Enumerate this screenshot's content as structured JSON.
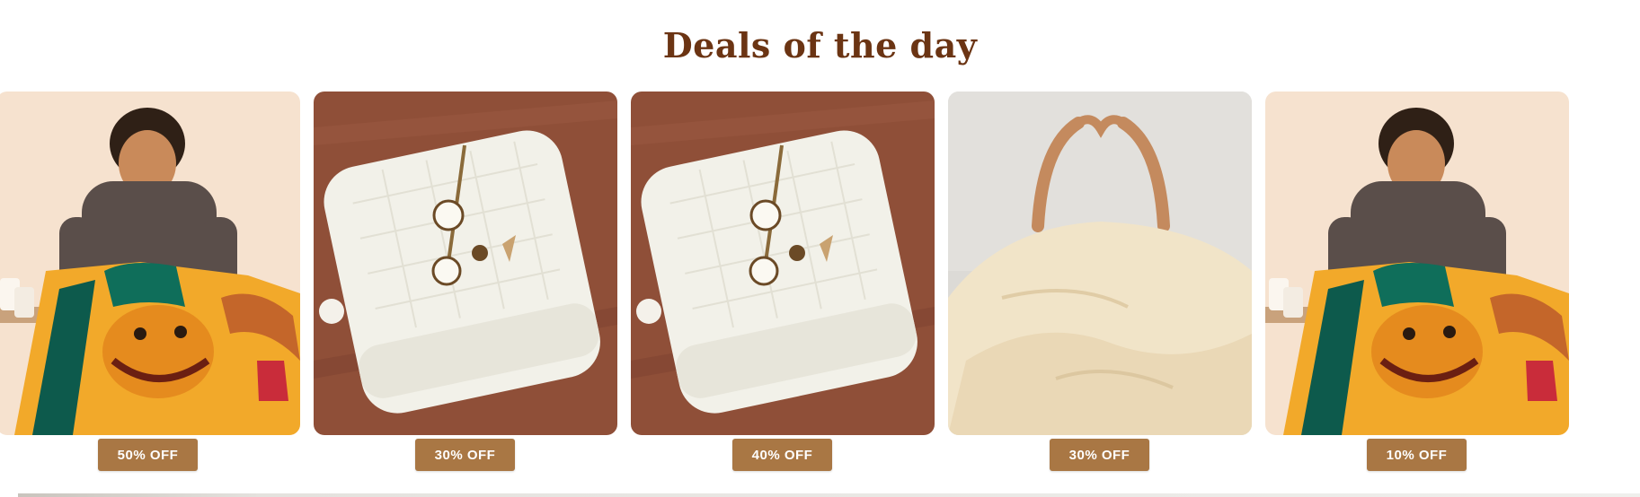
{
  "section": {
    "title": "Deals of the day"
  },
  "deals": [
    {
      "image": "child-lion-king-towel",
      "badge": "50% OFF"
    },
    {
      "image": "folded-white-towel-cotton",
      "badge": "30% OFF"
    },
    {
      "image": "folded-white-towel-cotton",
      "badge": "40% OFF"
    },
    {
      "image": "cream-duvet-heart-hands",
      "badge": "30% OFF"
    },
    {
      "image": "child-lion-king-towel",
      "badge": "10% OFF"
    }
  ],
  "colors": {
    "title": "#6b3413",
    "badge_bg": "#a97744",
    "badge_text": "#ffffff"
  }
}
